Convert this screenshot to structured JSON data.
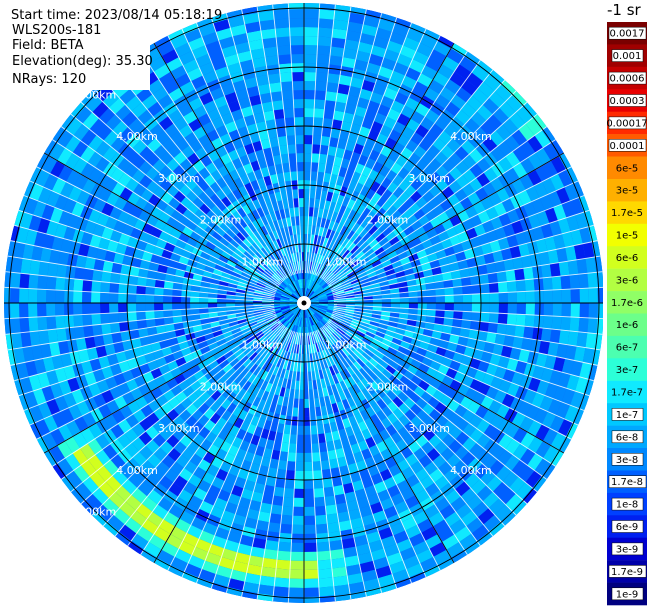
{
  "header": {
    "start_time": "Start time: 2023/08/14 05:18:19",
    "instrument": "WLS200s-181",
    "field": "Field: BETA",
    "elevation": "Elevation(deg): 35.30",
    "nrays": "NRays: 120"
  },
  "colorbar": {
    "unit": "-1 sr",
    "labels": [
      "0.0017",
      "0.001",
      "0.0006",
      "0.0003",
      "0.00017",
      "0.0001",
      "6e-5",
      "3e-5",
      "1.7e-5",
      "1e-5",
      "6e-6",
      "3e-6",
      "1.7e-6",
      "1e-6",
      "6e-7",
      "3e-7",
      "1.7e-7",
      "1e-7",
      "6e-8",
      "3e-8",
      "1.7e-8",
      "1e-8",
      "6e-9",
      "3e-9",
      "1.7e-9",
      "1e-9"
    ],
    "colors": [
      "#7a0000",
      "#a00000",
      "#c40000",
      "#e80000",
      "#ff2a00",
      "#ff5a00",
      "#ff8a00",
      "#ffb000",
      "#ffd800",
      "#f2ff00",
      "#d2ff1e",
      "#b2ff42",
      "#90ff66",
      "#6cff8a",
      "#4cffb0",
      "#2cffd8",
      "#10eaff",
      "#00c8ff",
      "#00a8ff",
      "#0088ff",
      "#0060ff",
      "#0040ff",
      "#0020f0",
      "#0000d0",
      "#0000a8",
      "#000080"
    ]
  },
  "range_rings": {
    "labels": [
      "1.00km",
      "2.00km",
      "3.00km",
      "4.00km",
      "5.00km"
    ]
  },
  "chart_data": {
    "type": "heatmap",
    "projection": "polar PPI (range rings in km)",
    "field": "BETA",
    "elevation_deg": 35.3,
    "nrays": 120,
    "range_rings_km": [
      1,
      2,
      3,
      4,
      5
    ],
    "radial_spokes_deg": [
      0,
      30,
      60,
      90,
      120,
      150,
      180,
      210,
      240,
      270,
      300,
      330
    ],
    "color_scale": "log",
    "value_range": [
      1e-09,
      0.0017
    ],
    "background_level": "about 1e-8 to 3e-8 sr^-1",
    "features": [
      {
        "description": "band of elevated backscatter",
        "range_km": 4.5,
        "azimuth_deg": [
          178,
          236
        ],
        "approx_value": "1.7e-6"
      },
      {
        "description": "weaker band",
        "range_km": 4.9,
        "azimuth_deg": [
          40,
          55
        ],
        "approx_value": "1.7e-7"
      }
    ]
  }
}
